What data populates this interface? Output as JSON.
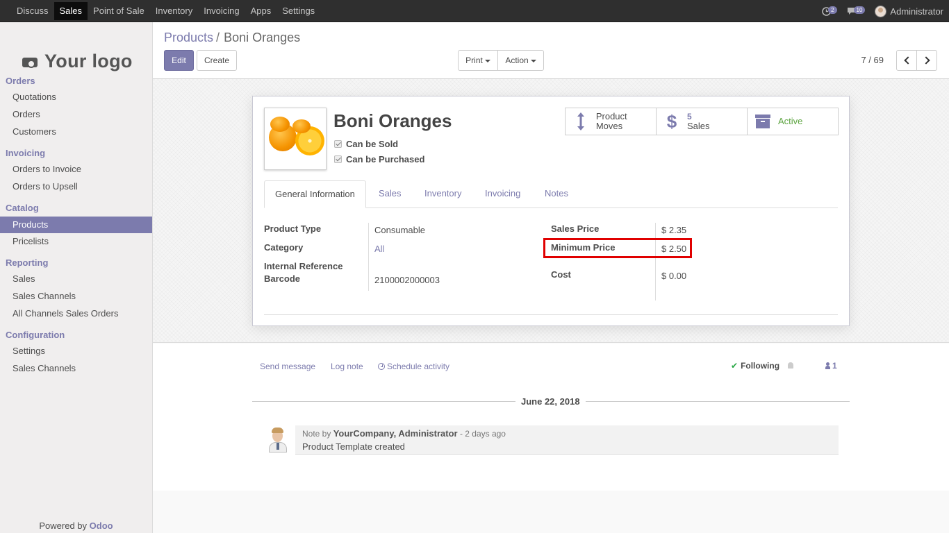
{
  "topbar": {
    "menu": [
      "Discuss",
      "Sales",
      "Point of Sale",
      "Inventory",
      "Invoicing",
      "Apps",
      "Settings"
    ],
    "activity_count": "2",
    "message_count": "10",
    "user": "Administrator"
  },
  "sidebar": {
    "logo_text": "Your logo",
    "sections": {
      "orders": {
        "title": "Orders",
        "items": [
          "Quotations",
          "Orders",
          "Customers"
        ]
      },
      "invoicing": {
        "title": "Invoicing",
        "items": [
          "Orders to Invoice",
          "Orders to Upsell"
        ]
      },
      "catalog": {
        "title": "Catalog",
        "items": [
          "Products",
          "Pricelists"
        ]
      },
      "reporting": {
        "title": "Reporting",
        "items": [
          "Sales",
          "Sales Channels",
          "All Channels Sales Orders"
        ]
      },
      "configuration": {
        "title": "Configuration",
        "items": [
          "Settings",
          "Sales Channels"
        ]
      }
    },
    "powered_prefix": "Powered by",
    "powered_brand": "Odoo"
  },
  "breadcrumb": {
    "parent": "Products",
    "separator": "/",
    "current": "Boni Oranges"
  },
  "toolbar": {
    "edit": "Edit",
    "create": "Create",
    "print": "Print",
    "action": "Action",
    "pager": "7 / 69"
  },
  "product": {
    "name": "Boni Oranges",
    "can_be_sold": "Can be Sold",
    "can_be_purchased": "Can be Purchased"
  },
  "smart_buttons": {
    "moves": "Product Moves",
    "sales_count": "5",
    "sales_label": "Sales",
    "active": "Active"
  },
  "tabs": [
    "General Information",
    "Sales",
    "Inventory",
    "Invoicing",
    "Notes"
  ],
  "fields": {
    "product_type_label": "Product Type",
    "product_type": "Consumable",
    "category_label": "Category",
    "category": "All",
    "internal_ref_label": "Internal Reference",
    "barcode_label": "Barcode",
    "barcode": "2100002000003",
    "sales_price_label": "Sales Price",
    "sales_price": "$ 2.35",
    "min_price_label": "Minimum Price",
    "min_price": "$ 2.50",
    "cost_label": "Cost",
    "cost": "$ 0.00"
  },
  "chatter": {
    "send_message": "Send message",
    "log_note": "Log note",
    "schedule_activity": "Schedule activity",
    "following": "Following",
    "followers": "1",
    "date": "June 22, 2018",
    "note_prefix": "Note by",
    "author": "YourCompany, Administrator",
    "time": "- 2 days ago",
    "body": "Product Template created"
  },
  "colors": {
    "brand": "#7c7bad",
    "highlight": "#e00000",
    "active_green": "#5ea542"
  }
}
